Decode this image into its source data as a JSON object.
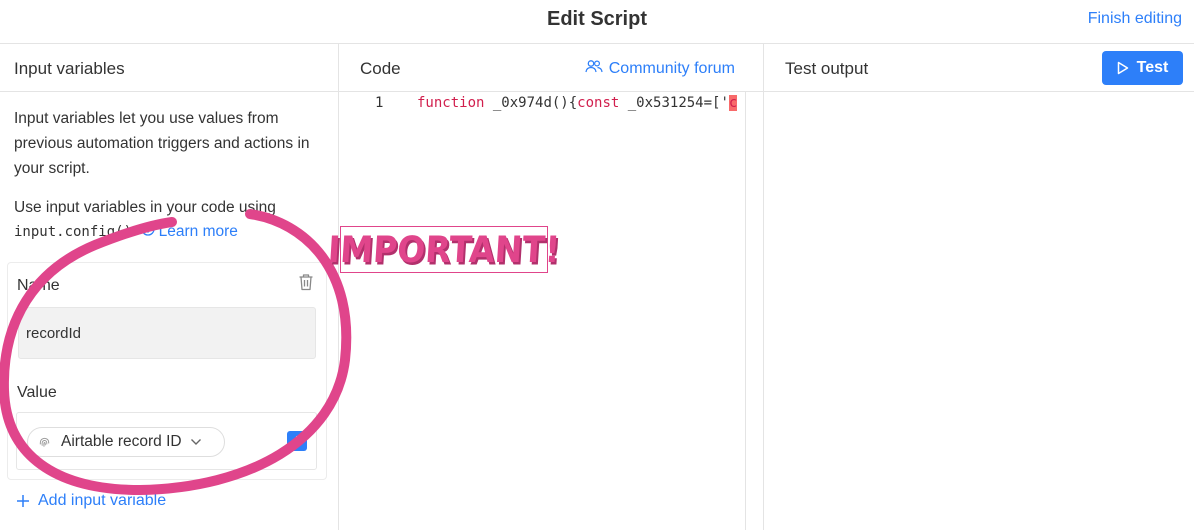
{
  "header": {
    "title": "Edit Script",
    "finish_label": "Finish editing"
  },
  "left_panel": {
    "title": "Input variables",
    "description": "Input variables let you use values from previous automation triggers and actions in your script.",
    "usage_prefix": "Use input variables in your code using",
    "usage_code": "input.config()",
    "usage_suffix": ".",
    "learn_more": "Learn more",
    "variable": {
      "name_label": "Name",
      "name_value": "recordId",
      "value_label": "Value",
      "value_pill": "Airtable record ID"
    },
    "add_variable": "Add input variable"
  },
  "code_panel": {
    "title": "Code",
    "forum_label": "Community forum",
    "line_number": "1",
    "code_keyword1": "function",
    "code_text1": " _0x974d(){",
    "code_keyword2": "const",
    "code_text2": " _0x531254=['",
    "code_string": "c"
  },
  "output_panel": {
    "title": "Test output",
    "test_label": "Test"
  },
  "annotation": {
    "sticker_text": "IMPORTANT!"
  },
  "colors": {
    "accent": "#2d7ff9",
    "annotation": "#e0458b",
    "keyword": "#d11f4d"
  }
}
